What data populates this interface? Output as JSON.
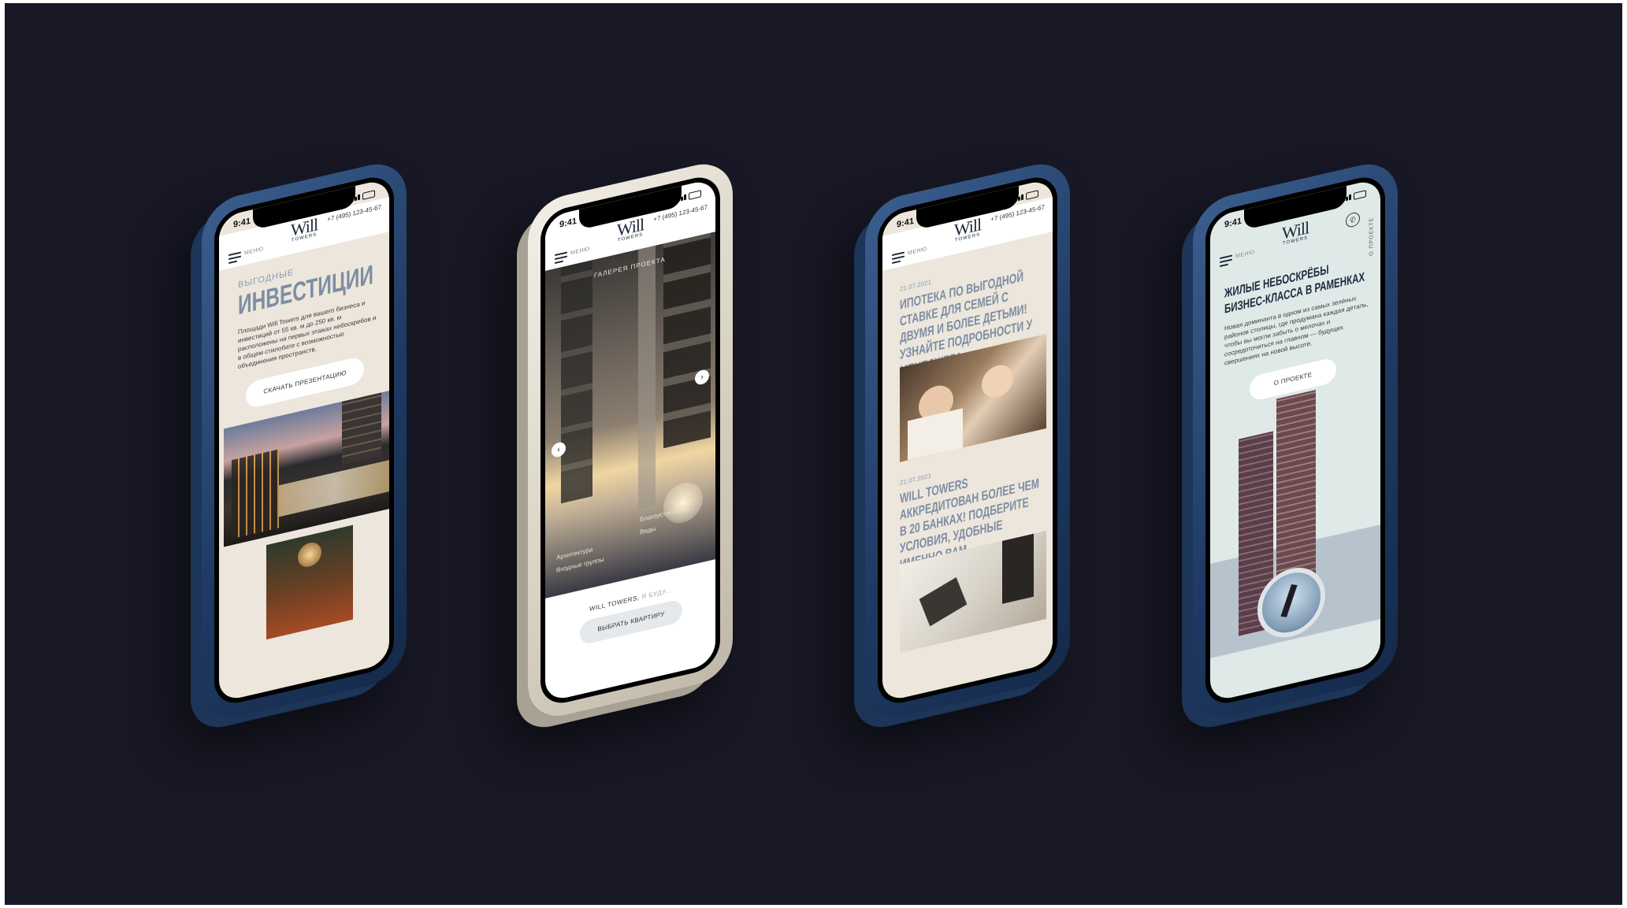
{
  "common": {
    "time": "9:41",
    "logo": "Will",
    "logo_sub": "TOWERS",
    "phone": "+7 (495) 123-45-67",
    "menu": "МЕНЮ"
  },
  "screen1": {
    "overline": "ВЫГОДНЫЕ",
    "title": "ИНВЕСТИЦИИ",
    "text": "Площади Will Towers для вашего бизнеса и инвестиций от 55 кв. м до 250 кв. м расположены на первых этажах небоскребов и в общем стилобате с возможностью объединения пространств.",
    "button": "СКАЧАТЬ ПРЕЗЕНТАЦИЮ"
  },
  "screen2": {
    "gallery_title": "ГАЛЕРЕЯ ПРОЕКТА",
    "nav_left": [
      "Архитектура",
      "Входные группы"
    ],
    "nav_right": [
      "Благоустройство",
      "Виды"
    ],
    "tagline_a": "WILL TOWERS,",
    "tagline_b": "Я БУДУ...",
    "button": "ВЫБРАТЬ КВАРТИРУ"
  },
  "screen3": {
    "news": [
      {
        "date": "21.07.2021",
        "title": "ИПОТЕКА ПО ВЫГОДНОЙ СТАВКЕ ДЛЯ СЕМЕЙ С ДВУМЯ И БОЛЕЕ ДЕТЬМИ! УЗНАЙТЕ ПОДРОБНОСТИ У МЕНЕДЖЕРА."
      },
      {
        "date": "21.07.2021",
        "title": "WILL TOWERS АККРЕДИТОВАН БОЛЕЕ ЧЕМ В 20 БАНКАХ! ПОДБЕРИТЕ УСЛОВИЯ, УДОБНЫЕ ИМЕННО ВАМ."
      }
    ]
  },
  "screen4": {
    "side_label": "О ПРОЕКТЕ",
    "title": "ЖИЛЫЕ НЕБОСКРЁБЫ БИЗНЕС-КЛАССА В РАМЕНКАХ",
    "text": "Новая доминанта в одном из самых зелёных районов столицы, где продумана каждая деталь, чтобы вы могли забыть о мелочах и сосредоточиться на главном — будущих свершениях на новой высоте.",
    "button": "О ПРОЕКТЕ"
  },
  "colors": {
    "background": "#181826",
    "frame_blue": "#1e3a63",
    "frame_silver": "#d8d2c4",
    "cream": "#ece6dc",
    "mint": "#dfeae8",
    "heading": "#7d8ea3"
  }
}
